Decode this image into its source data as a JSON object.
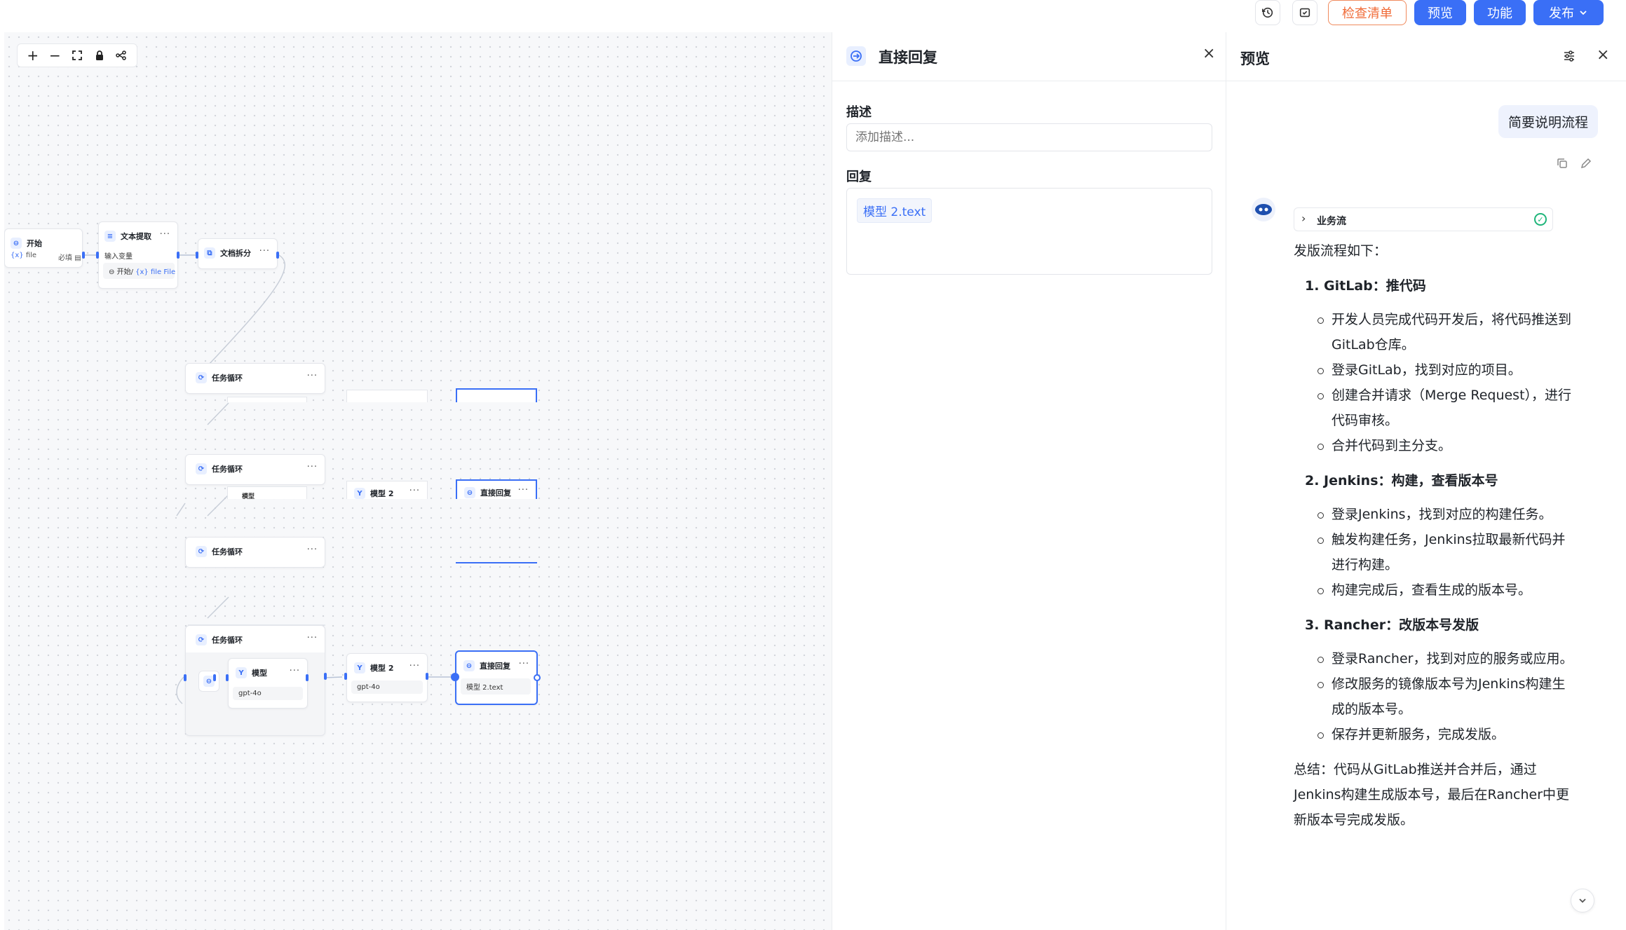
{
  "topbar": {
    "history_icon": "history-icon",
    "checklist_icon": "checklist-icon",
    "checklist_label": "检查清单",
    "preview_label": "预览",
    "features_label": "功能",
    "publish_label": "发布",
    "accent_color": "#3a6ff6"
  },
  "canvas": {
    "zoom_tools": [
      "+",
      "−",
      "⛶",
      "🔒",
      "⋔"
    ],
    "nodes": {
      "start": {
        "title": "开始",
        "field_name": "file",
        "field_var": "{x}",
        "required": "必填"
      },
      "extract": {
        "title": "文本提取",
        "sub": "输入变量",
        "source_node": "开始",
        "source_var": "file",
        "source_type": "File",
        "var_prefix": "{x}"
      },
      "split": {
        "title": "文档拆分"
      },
      "loop1": {
        "title": "任务循环"
      },
      "loop2": {
        "title": "任务循环"
      },
      "loop3": {
        "title": "任务循环"
      },
      "loop4": {
        "title": "任务循环",
        "model_title": "模型",
        "model_value": "gpt-4o"
      },
      "model2_row2": {
        "title": "模型 2"
      },
      "reply_row2": {
        "title": "直接回复"
      },
      "model2": {
        "title": "模型 2",
        "value": "gpt-4o"
      },
      "reply": {
        "title": "直接回复",
        "value": "模型 2.text"
      },
      "partial_model_row2": {
        "title": "模型"
      }
    },
    "menu_dots": "···"
  },
  "config_panel": {
    "title": "直接回复",
    "close": "×",
    "desc_label": "描述",
    "desc_placeholder": "添加描述...",
    "reply_label": "回复",
    "reply_var": "模型 2.text"
  },
  "preview_panel": {
    "title": "预览",
    "close": "×",
    "settings_icon": "sliders-icon",
    "user_message": "简要说明流程",
    "flow_chip": "业务流",
    "intro": "发版流程如下：",
    "sections": [
      {
        "heading": "1. GitLab：推代码",
        "items": [
          "开发人员完成代码开发后，将代码推送到GitLab仓库。",
          "登录GitLab，找到对应的项目。",
          "创建合并请求（Merge Request），进行代码审核。",
          "合并代码到主分支。"
        ]
      },
      {
        "heading": "2. Jenkins：构建，查看版本号",
        "items": [
          "登录Jenkins，找到对应的构建任务。",
          "触发构建任务，Jenkins拉取最新代码并进行构建。",
          "构建完成后，查看生成的版本号。"
        ]
      },
      {
        "heading": "3. Rancher：改版本号发版",
        "items": [
          "登录Rancher，找到对应的服务或应用。",
          "修改服务的镜像版本号为Jenkins构建生成的版本号。",
          "保存并更新服务，完成发版。"
        ]
      }
    ],
    "summary": "总结：代码从GitLab推送并合并后，通过Jenkins构建生成版本号，最后在Rancher中更新版本号完成发版。"
  }
}
